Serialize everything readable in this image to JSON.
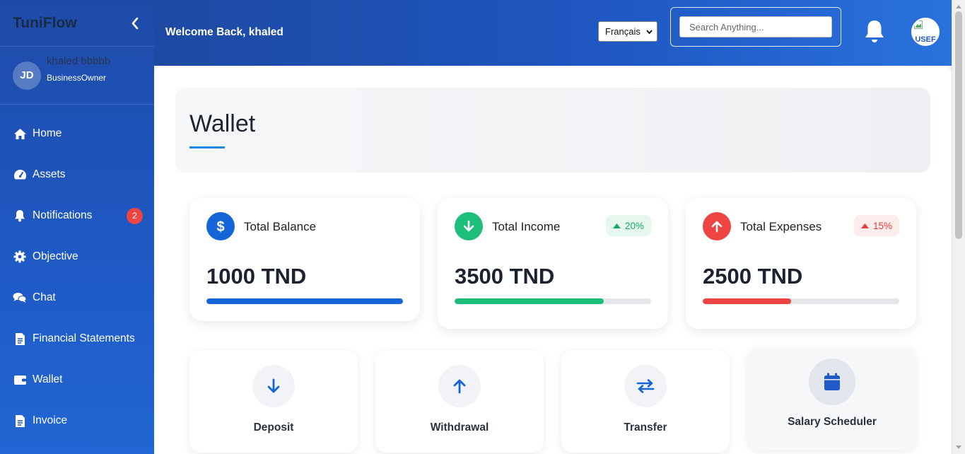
{
  "app": {
    "name": "TuniFlow"
  },
  "user": {
    "initials": "JD",
    "name": "khaled bbbbb",
    "role": "BusinessOwner"
  },
  "sidebar": {
    "items": [
      {
        "label": "Home",
        "icon": "home-icon"
      },
      {
        "label": "Assets",
        "icon": "gauge-icon"
      },
      {
        "label": "Notifications",
        "icon": "bell-icon",
        "badge": "2"
      },
      {
        "label": "Objective",
        "icon": "gear-icon"
      },
      {
        "label": "Chat",
        "icon": "chat-icon"
      },
      {
        "label": "Financial Statements",
        "icon": "document-icon"
      },
      {
        "label": "Wallet",
        "icon": "wallet-icon"
      },
      {
        "label": "Invoice",
        "icon": "invoice-icon"
      }
    ]
  },
  "header": {
    "welcome": "Welcome Back, khaled",
    "language": "Français",
    "search_placeholder": "Search Anything...",
    "profile_alt": "USEF"
  },
  "page": {
    "title": "Wallet"
  },
  "stats": [
    {
      "label": "Total Balance",
      "value": "1000 TND",
      "icon": "dollar-icon",
      "color": "#1565d8",
      "progress": 1.0
    },
    {
      "label": "Total Income",
      "value": "3500 TND",
      "icon": "arrow-down-icon",
      "color": "#1dbd7a",
      "trend": "20%",
      "progress": 0.76
    },
    {
      "label": "Total Expenses",
      "value": "2500 TND",
      "icon": "arrow-up-icon",
      "color": "#ef4444",
      "trend": "15%",
      "progress": 0.45
    }
  ],
  "actions": [
    {
      "label": "Deposit",
      "icon": "arrow-down-icon"
    },
    {
      "label": "Withdrawal",
      "icon": "arrow-up-icon"
    },
    {
      "label": "Transfer",
      "icon": "transfer-icon"
    },
    {
      "label": "Salary Scheduler",
      "icon": "calendar-icon"
    }
  ],
  "colors": {
    "accent": "#1565d8",
    "income": "#1dbd7a",
    "expense": "#ef4444",
    "sidebar": "#1f56c0"
  }
}
